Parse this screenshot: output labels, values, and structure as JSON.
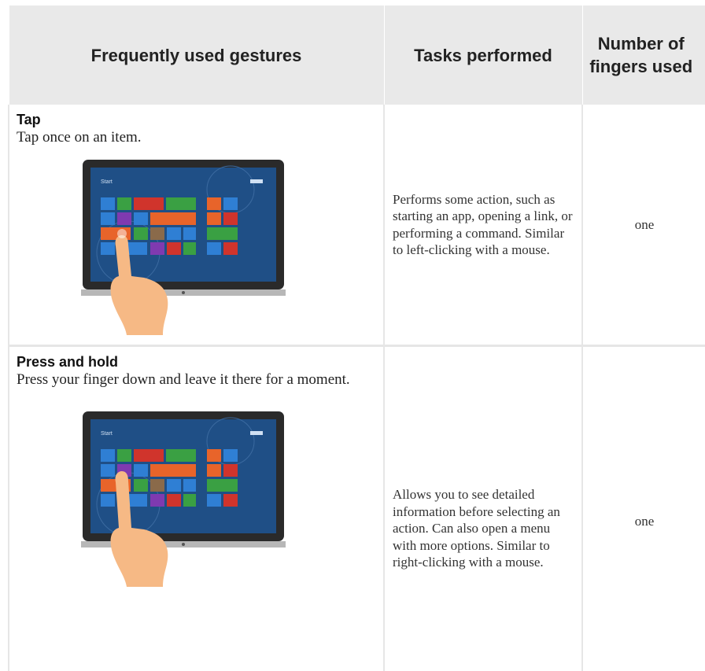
{
  "header": {
    "col_gesture": "Frequently used gestures",
    "col_tasks": "Tasks performed",
    "col_fingers": "Number of fingers used"
  },
  "rows": [
    {
      "title": "Tap",
      "description": "Tap once on an item.",
      "task": "Performs some action, such as starting an app, opening a link, or performing a command. Similar to left-clicking with a mouse.",
      "fingers": "one",
      "screen_label": "Start"
    },
    {
      "title": "Press and hold",
      "description": "Press your finger down and leave it there for a moment.",
      "task": "Allows you to see detailed information before selecting an action. Can also open a menu with more options. Similar to right-clicking with a mouse.",
      "fingers": "one",
      "screen_label": "Start"
    }
  ],
  "colors": {
    "header_bg": "#e9e9e9",
    "border": "#e6e6e6",
    "screen_bg": "#1f4f86",
    "hand": "#f6b985"
  }
}
